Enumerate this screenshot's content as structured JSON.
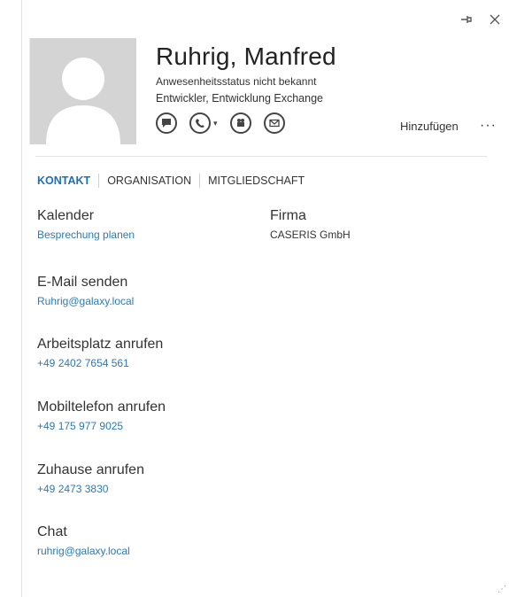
{
  "contact": {
    "name": "Ruhrig, Manfred",
    "presence": "Anwesenheitsstatus nicht bekannt",
    "title": "Entwickler, Entwicklung Exchange"
  },
  "header": {
    "pin_icon": "pin-icon",
    "close_icon": "close-icon",
    "add_label": "Hinzufügen",
    "more_label": "···"
  },
  "actions": [
    "chat-icon",
    "phone-icon",
    "video-icon",
    "mail-icon"
  ],
  "tabs": [
    {
      "label": "KONTAKT",
      "active": true
    },
    {
      "label": "ORGANISATION",
      "active": false
    },
    {
      "label": "MITGLIEDSCHAFT",
      "active": false
    }
  ],
  "fields": {
    "calendar": {
      "label": "Kalender",
      "value": "Besprechung planen"
    },
    "company": {
      "label": "Firma",
      "value": "CASERIS GmbH"
    },
    "email": {
      "label": "E-Mail senden",
      "value": "Ruhrig@galaxy.local"
    },
    "work_phone": {
      "label": "Arbeitsplatz anrufen",
      "value": "+49 2402 7654 561"
    },
    "mobile": {
      "label": "Mobiltelefon anrufen",
      "value": "+49 175 977 9025"
    },
    "home": {
      "label": "Zuhause anrufen",
      "value": "+49 2473 3830"
    },
    "chat": {
      "label": "Chat",
      "value": "ruhrig@galaxy.local"
    }
  },
  "colors": {
    "accent": "#1e6fb5",
    "link": "#2a7ab8"
  }
}
